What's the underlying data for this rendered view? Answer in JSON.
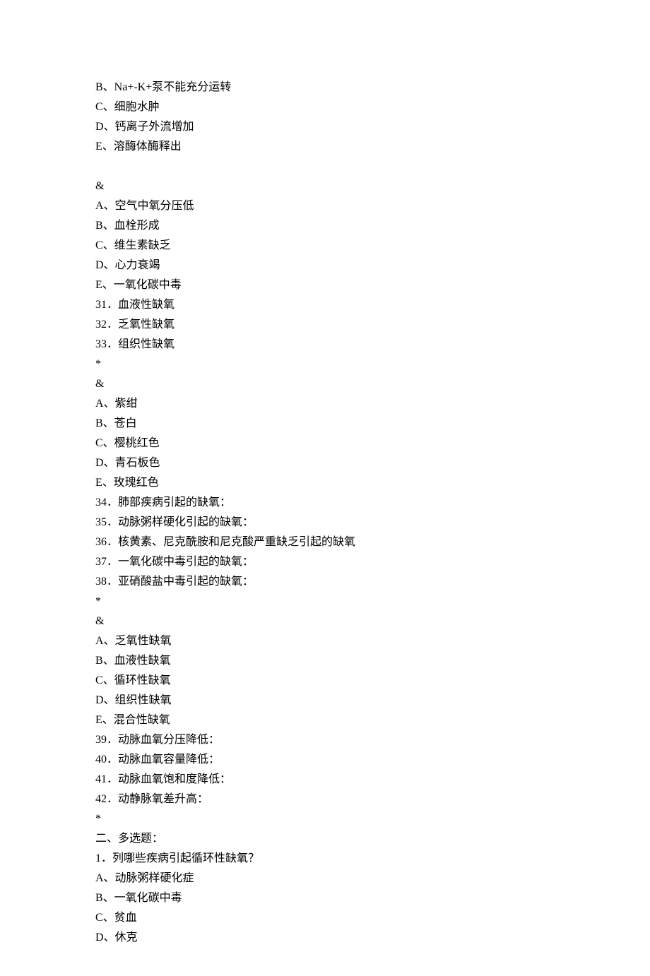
{
  "lines": [
    "B、Na+-K+泵不能充分运转",
    "C、细胞水肿",
    "D、钙离子外流增加",
    "E、溶酶体酶释出",
    "",
    "&",
    "A、空气中氧分压低",
    "B、血栓形成",
    "C、维生素缺乏",
    "D、心力衰竭",
    "E、一氧化碳中毒",
    "31．血液性缺氧",
    "32．乏氧性缺氧",
    "33．组织性缺氧",
    "*",
    "&",
    "A、紫绀",
    "B、苍白",
    "C、樱桃红色",
    "D、青石板色",
    "E、玫瑰红色",
    "34．肺部疾病引起的缺氧：",
    "35．动脉粥样硬化引起的缺氧：",
    "36．核黄素、尼克酰胺和尼克酸严重缺乏引起的缺氧",
    "37．一氧化碳中毒引起的缺氧：",
    "38．亚硝酸盐中毒引起的缺氧：",
    "*",
    "&",
    "A、乏氧性缺氧",
    "B、血液性缺氧",
    "C、循环性缺氧",
    "D、组织性缺氧",
    "E、混合性缺氧",
    "39．动脉血氧分压降低：",
    "40．动脉血氧容量降低：",
    "41．动脉血氧饱和度降低：",
    "42．动静脉氧差升高：",
    "*",
    "二、多选题：",
    "1．列哪些疾病引起循环性缺氧？",
    "A、动脉粥样硬化症",
    "B、一氧化碳中毒",
    "C、贫血",
    "D、休克"
  ]
}
